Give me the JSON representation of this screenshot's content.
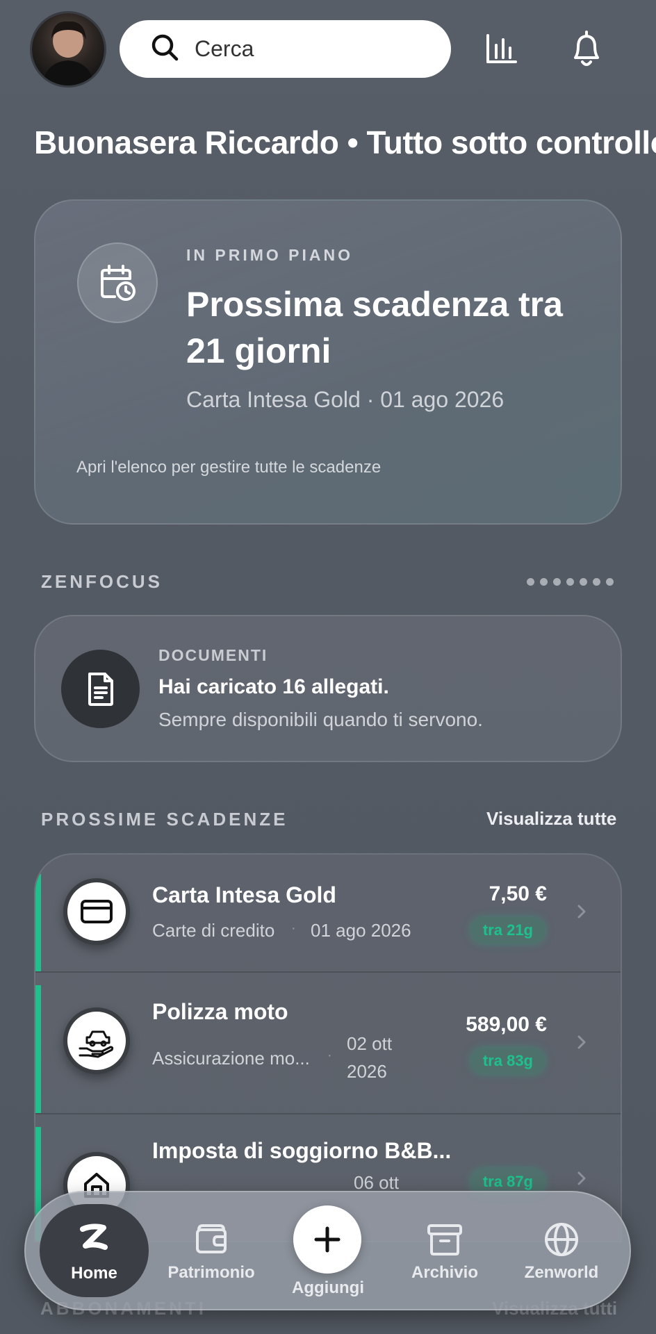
{
  "header": {
    "search_placeholder": "Cerca",
    "icons": [
      "stats-icon",
      "bell-icon"
    ]
  },
  "greeting": "Buonasera Riccardo • Tutto sotto controllo",
  "highlight": {
    "kicker": "IN PRIMO PIANO",
    "title": "Prossima scadenza tra 21 giorni",
    "subtitle": "Carta Intesa Gold · 01 ago 2026",
    "note": "Apri l'elenco per gestire tutte le scadenze",
    "icon": "calendar-clock-icon"
  },
  "zenfocus": {
    "title": "ZENFOCUS",
    "page_dots": 7,
    "card": {
      "kicker": "DOCUMENTI",
      "title": "Hai caricato 16 allegati.",
      "subtitle": "Sempre disponibili quando ti servono.",
      "icon": "document-icon"
    }
  },
  "deadlines": {
    "title": "PROSSIME SCADENZE",
    "view_all": "Visualizza tutte",
    "items": [
      {
        "name": "Carta Intesa Gold",
        "category": "Carte di credito",
        "date": "01 ago 2026",
        "amount": "7,50 €",
        "badge": "tra 21g",
        "icon": "credit-card-icon"
      },
      {
        "name": "Polizza moto",
        "category": "Assicurazione mo...",
        "date_line1": "02 ott",
        "date_line2": "2026",
        "amount": "589,00 €",
        "badge": "tra 83g",
        "icon": "car-insurance-icon"
      },
      {
        "name": "Imposta di soggiorno B&B...",
        "date_line1": "06 ott",
        "badge": "tra 87g",
        "icon": "house-icon"
      }
    ],
    "accent_color": "#1ec08c"
  },
  "subscriptions": {
    "title": "ABBONAMENTI",
    "view_all": "Visualizza tutti"
  },
  "nav": {
    "home": "Home",
    "assets": "Patrimonio",
    "add": "Aggiungi",
    "archive": "Archivio",
    "world": "Zenworld"
  }
}
